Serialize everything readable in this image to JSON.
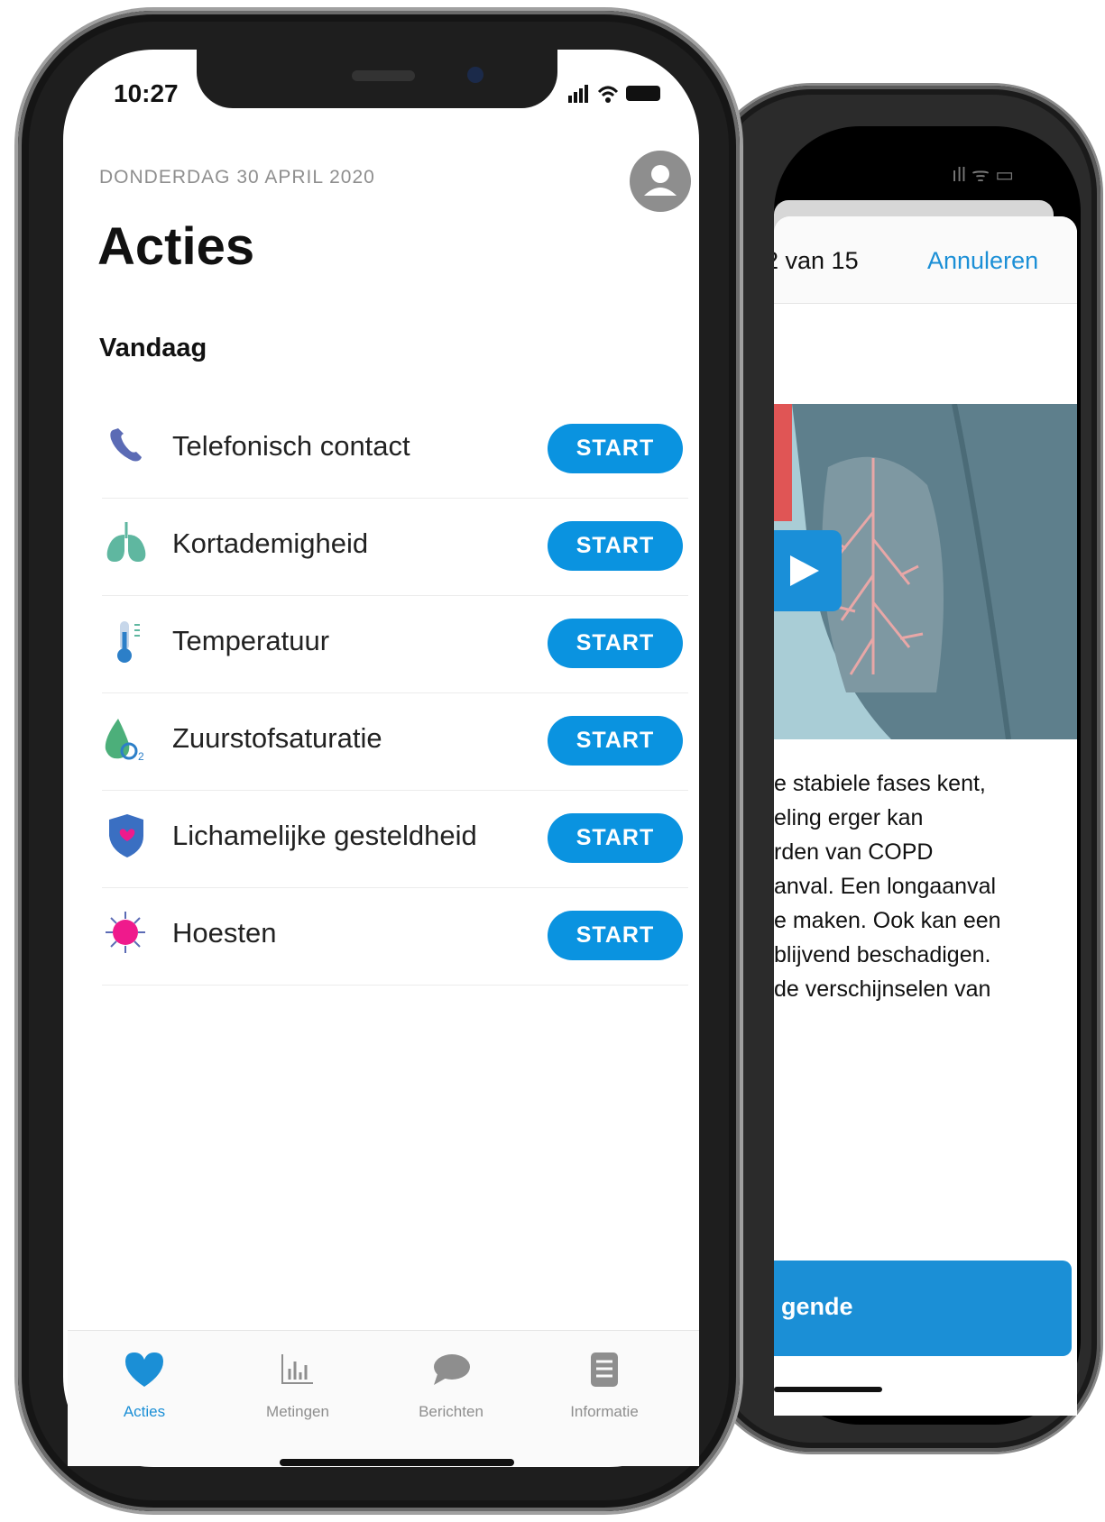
{
  "back_screen": {
    "progress_label": "2 van 15",
    "cancel_label": "Annuleren",
    "text_lines": [
      "e stabiele fases kent,",
      "eling erger kan",
      "rden van COPD",
      "anval. Een longaanval",
      "e maken. Ook kan een",
      " blijvend beschadigen.",
      " de verschijnselen van"
    ],
    "next_label": "gende"
  },
  "status_bar": {
    "time": "10:27"
  },
  "header": {
    "date": "DONDERDAG 30 APRIL 2020",
    "title": "Acties",
    "section": "Vandaag"
  },
  "actions": [
    {
      "label": "Telefonisch contact",
      "button": "START",
      "icon": "phone-icon"
    },
    {
      "label": "Kortademigheid",
      "button": "START",
      "icon": "lungs-icon"
    },
    {
      "label": "Temperatuur",
      "button": "START",
      "icon": "thermometer-icon"
    },
    {
      "label": "Zuurstofsaturatie",
      "button": "START",
      "icon": "oxygen-drop-icon"
    },
    {
      "label": "Lichamelijke gesteldheid",
      "button": "START",
      "icon": "shield-icon"
    },
    {
      "label": "Hoesten",
      "button": "START",
      "icon": "virus-icon"
    }
  ],
  "tabbar": {
    "tabs": [
      {
        "label": "Acties",
        "icon": "heart-icon",
        "active": true
      },
      {
        "label": "Metingen",
        "icon": "bar-chart-icon",
        "active": false
      },
      {
        "label": "Berichten",
        "icon": "chat-bubble-icon",
        "active": false
      },
      {
        "label": "Informatie",
        "icon": "document-icon",
        "active": false
      }
    ]
  },
  "colors": {
    "accent": "#0a93e0",
    "phone_icon": "#5b6bb5",
    "lungs_icon": "#5fb7a0",
    "thermo_icon": "#2c7fc8",
    "oxygen_icon": "#4caf7a",
    "shield_icon": "#3a6fc2",
    "virus_icon": "#ef1a8c"
  }
}
